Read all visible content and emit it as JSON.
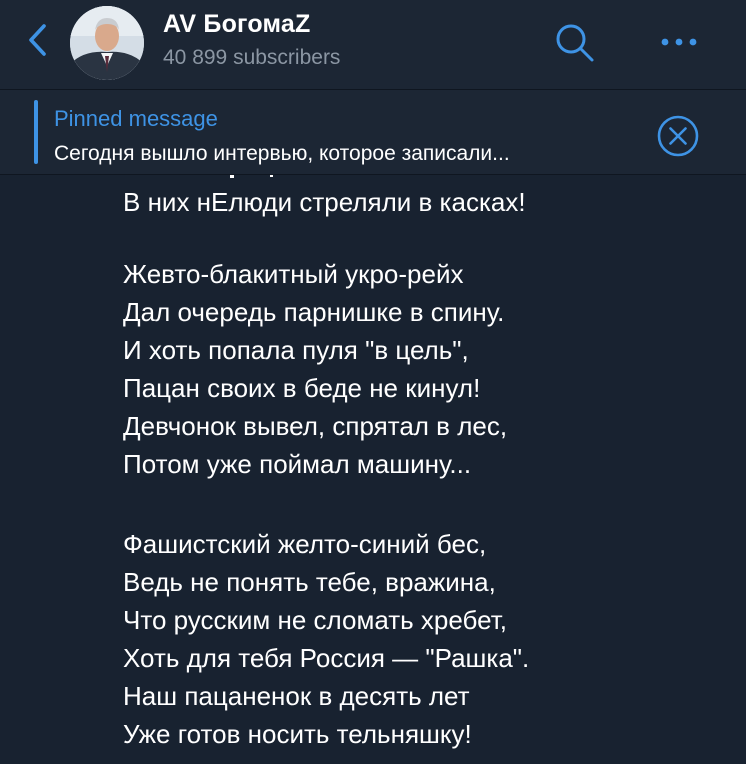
{
  "header": {
    "title": "AV БогомаZ",
    "subscribers": "40 899 subscribers",
    "icons": [
      "chevron-left-icon",
      "search-icon",
      "more-icon"
    ]
  },
  "pinned": {
    "label": "Pinned message",
    "text": "Сегодня вышло интервью, которое записали...",
    "close_icon": "close-circle-icon"
  },
  "message": {
    "lines": [
      "В них нЕлюди стреляли в касках!",
      "",
      "Жевто-блакитный укро-рейх",
      "Дал очередь парнишке в спину.",
      "И хоть попала пуля \"в цель\",",
      "Пацан своих в беде не кинул!",
      "Девчонок вывел, спрятал в лес,",
      "Потом уже поймал машину...",
      "",
      "Фашистский желто-синий бес,",
      "Ведь не понять тебе, вражина,",
      "Что русским не сломать хребет,",
      "Хоть для тебя Россия — \"Рашка\".",
      "Наш пацаненок в десять лет",
      "Уже готов носить тельняшку!"
    ]
  },
  "colors": {
    "background": "#182230",
    "header_bg": "#1c2634",
    "accent": "#3e93e5",
    "muted": "#8b96a3"
  }
}
